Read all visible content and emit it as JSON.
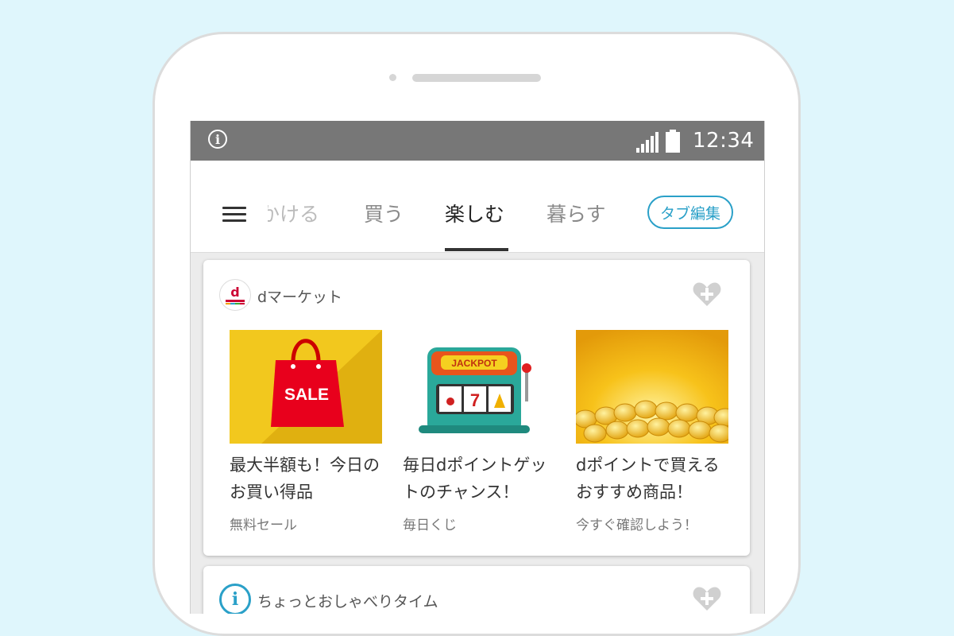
{
  "status_bar": {
    "time": "12:34"
  },
  "tabs": {
    "items": [
      {
        "label": "かける"
      },
      {
        "label": "買う"
      },
      {
        "label": "楽しむ"
      },
      {
        "label": "暮らす"
      }
    ],
    "edit_label": "タブ編集"
  },
  "card1": {
    "title": "dマーケット",
    "logo_letter": "d",
    "items": [
      {
        "title": "最大半額も！今日のお買い得品",
        "subtitle": "無料セール",
        "badge": "SALE"
      },
      {
        "title": "毎日dポイントゲットのチャンス！",
        "subtitle": "毎日くじ",
        "badge": "JACKPOT",
        "reels": "7"
      },
      {
        "title": "dポイントで買えるおすすめ商品！",
        "subtitle": "今すぐ確認しよう！"
      }
    ]
  },
  "card2": {
    "title": "ちょっとおしゃべりタイム"
  },
  "colors": {
    "accent": "#2aa0c8",
    "statusbar": "#777777",
    "background": "#dff6fc"
  }
}
